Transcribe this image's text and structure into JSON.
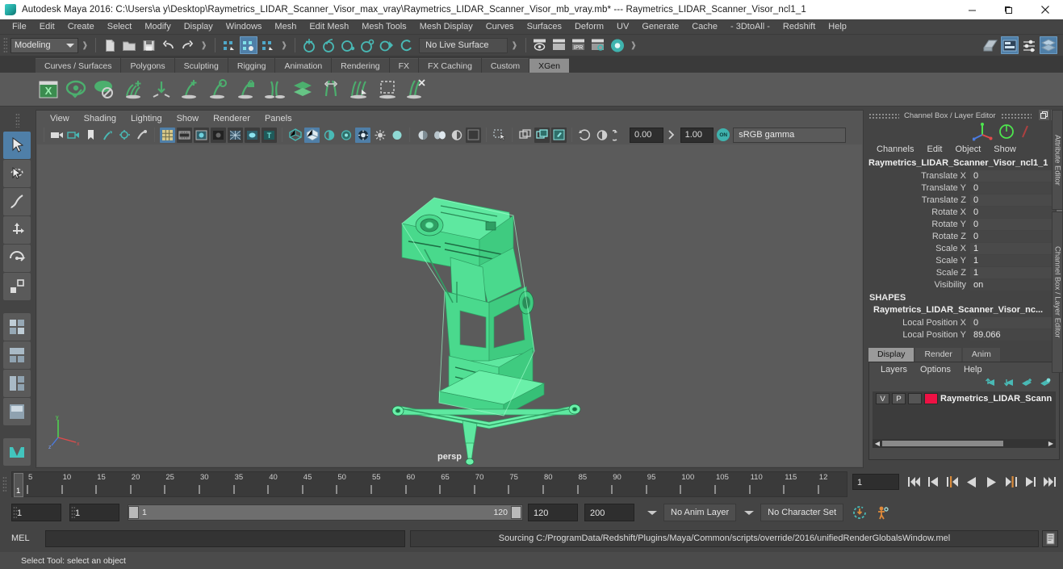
{
  "window": {
    "title": "Autodesk Maya 2016: C:\\Users\\a y\\Desktop\\Raymetrics_LIDAR_Scanner_Visor_max_vray\\Raymetrics_LIDAR_Scanner_Visor_mb_vray.mb*  ---  Raymetrics_LIDAR_Scanner_Visor_ncl1_1",
    "minimize": "—",
    "maximize": "❐",
    "close": "✕",
    "app_icon": "maya-icon"
  },
  "menubar": {
    "items": [
      "File",
      "Edit",
      "Create",
      "Select",
      "Modify",
      "Display",
      "Windows",
      "Mesh",
      "Edit Mesh",
      "Mesh Tools",
      "Mesh Display",
      "Curves",
      "Surfaces",
      "Deform",
      "UV",
      "Generate",
      "Cache",
      "- 3DtoAll -",
      "Redshift",
      "Help"
    ]
  },
  "statusline": {
    "menuset": "Modeling",
    "live_surface": "No Live Surface",
    "snap_value_1": "0.00",
    "snap_value_2": "1.00",
    "gamma": "sRGB gamma",
    "gamma_toggle": "ON",
    "icons": [
      "new-scene-icon",
      "open-scene-icon",
      "save-scene-icon",
      "undo-icon",
      "redo-icon",
      "select-by-hierarchy-icon",
      "select-by-object-icon",
      "select-by-component-icon",
      "snap-to-grid-icon",
      "snap-to-curve-icon",
      "snap-to-point-icon",
      "snap-to-projected-center-icon",
      "snap-to-view-plane-icon",
      "make-live-icon",
      "render-current-frame-icon",
      "ipr-render-icon",
      "render-settings-icon",
      "hypershade-icon",
      "render-view-icon",
      "outliner-icon",
      "attribute-editor-icon",
      "tool-settings-icon",
      "channel-box-icon"
    ]
  },
  "shelf": {
    "tabs": [
      {
        "label": "Curves / Surfaces",
        "active": false
      },
      {
        "label": "Polygons",
        "active": false
      },
      {
        "label": "Sculpting",
        "active": false
      },
      {
        "label": "Rigging",
        "active": false
      },
      {
        "label": "Animation",
        "active": false
      },
      {
        "label": "Rendering",
        "active": false
      },
      {
        "label": "FX",
        "active": false
      },
      {
        "label": "FX Caching",
        "active": false
      },
      {
        "label": "Custom",
        "active": false
      },
      {
        "label": "XGen",
        "active": true
      }
    ],
    "icons": [
      "xgen-window-icon",
      "xgen-preview-icon",
      "xgen-disable-preview-icon",
      "xgen-add-guides-icon",
      "xgen-place-guide-icon",
      "xgen-grow-guide-icon",
      "xgen-select-guide-icon",
      "xgen-lock-guide-icon",
      "xgen-mirror-guides-icon",
      "xgen-layers-icon",
      "xgen-length-tool-icon",
      "xgen-comb-brush-icon",
      "xgen-region-tool-icon",
      "xgen-delete-guides-icon"
    ]
  },
  "toolbox": {
    "items": [
      {
        "name": "select-tool",
        "selected": true
      },
      {
        "name": "lasso-select-tool",
        "selected": false
      },
      {
        "name": "paint-select-tool",
        "selected": false
      },
      {
        "name": "move-tool",
        "selected": false
      },
      {
        "name": "rotate-tool",
        "selected": false
      },
      {
        "name": "scale-tool",
        "selected": false
      },
      {
        "name": "four-view-layout-icon",
        "selected": false
      },
      {
        "name": "persp-outliner-layout-icon",
        "selected": false
      },
      {
        "name": "persp-graph-layout-icon",
        "selected": false
      },
      {
        "name": "persp-hypershade-layout-icon",
        "selected": false
      },
      {
        "name": "maya-logo-icon",
        "selected": false
      }
    ]
  },
  "viewport": {
    "menus": [
      "View",
      "Shading",
      "Lighting",
      "Show",
      "Renderer",
      "Panels"
    ],
    "camera_label": "persp",
    "toolbar_icons": [
      "select-camera-icon",
      "camera-attributes-icon",
      "bookmark-icon",
      "image-plane-icon",
      "two-sided-lighting-icon",
      "shadows-icon",
      "grid-toggle-icon",
      "film-gate-icon",
      "resolution-gate-icon",
      "gate-mask-icon",
      "wireframe-on-shaded-icon",
      "xray-icon",
      "texture-icon",
      "smooth-shade-icon",
      "flat-shade-icon",
      "wireframe-icon",
      "bounding-box-icon",
      "hardware-texturing-icon",
      "lighting-icon",
      "shadow-icon",
      "ambient-occlusion-icon",
      "motion-blur-icon",
      "multisample-icon",
      "isolate-select-icon",
      "panel-zoom-icon",
      "grab-color-icon",
      "snapshot-icon",
      "exposure-icon",
      "gamma-icon",
      "color-management-icon"
    ],
    "model_color": "#5ee8a0",
    "background_color": "#5b5b5b",
    "axis_labels": [
      "y",
      "x",
      "z"
    ]
  },
  "channel_box": {
    "panel_title": "Channel Box / Layer Editor",
    "menus": [
      "Channels",
      "Edit",
      "Object",
      "Show"
    ],
    "node_name": "Raymetrics_LIDAR_Scanner_Visor_ncl1_1",
    "transform_attrs": [
      {
        "label": "Translate X",
        "value": "0"
      },
      {
        "label": "Translate Y",
        "value": "0"
      },
      {
        "label": "Translate Z",
        "value": "0"
      },
      {
        "label": "Rotate X",
        "value": "0"
      },
      {
        "label": "Rotate Y",
        "value": "0"
      },
      {
        "label": "Rotate Z",
        "value": "0"
      },
      {
        "label": "Scale X",
        "value": "1"
      },
      {
        "label": "Scale Y",
        "value": "1"
      },
      {
        "label": "Scale Z",
        "value": "1"
      },
      {
        "label": "Visibility",
        "value": "on"
      }
    ],
    "shapes_header": "SHAPES",
    "shape_node": "Raymetrics_LIDAR_Scanner_Visor_nc...",
    "shape_attrs": [
      {
        "label": "Local Position X",
        "value": "0"
      },
      {
        "label": "Local Position Y",
        "value": "89.066"
      }
    ]
  },
  "layer_editor": {
    "tabs": [
      {
        "label": "Display",
        "active": true
      },
      {
        "label": "Render",
        "active": false
      },
      {
        "label": "Anim",
        "active": false
      }
    ],
    "menus": [
      "Layers",
      "Options",
      "Help"
    ],
    "toolbar_icons": [
      "move-layer-up-icon",
      "move-layer-down-icon",
      "new-layer-icon",
      "new-layer-from-selected-icon"
    ],
    "layers": [
      {
        "visibility": "V",
        "playback": "P",
        "shading": "",
        "color": "#ee1144",
        "name": "Raymetrics_LIDAR_Scann"
      }
    ]
  },
  "side_tabs": [
    {
      "label": "Attribute Editor"
    },
    {
      "label": "Channel Box / Layer Editor"
    }
  ],
  "timeline": {
    "ticks": [
      "5",
      "10",
      "15",
      "20",
      "25",
      "30",
      "35",
      "40",
      "45",
      "50",
      "55",
      "60",
      "65",
      "70",
      "75",
      "80",
      "85",
      "90",
      "95",
      "100",
      "105",
      "110",
      "115",
      "12"
    ],
    "current_frame": "1",
    "current_frame_field": "1",
    "playback_buttons": [
      "go-to-start-icon",
      "step-back-keyframe-icon",
      "step-back-frame-icon",
      "play-backwards-icon",
      "play-forwards-icon",
      "step-forward-frame-icon",
      "step-forward-keyframe-icon",
      "go-to-end-icon"
    ]
  },
  "range_slider": {
    "anim_start": "1",
    "anim_end": "1",
    "range_start": "1",
    "range_end": "120",
    "playback_end": "120",
    "anim_total_end": "200",
    "anim_layer": "No Anim Layer",
    "character_set": "No Character Set",
    "auto_key_icon": "auto-keyframe-icon",
    "anim_prefs_icon": "animation-preferences-icon"
  },
  "command_line": {
    "label": "MEL",
    "input_value": "",
    "input_placeholder": "",
    "output": "Sourcing C:/ProgramData/Redshift/Plugins/Maya/Common/scripts/override/2016/unifiedRenderGlobalsWindow.mel",
    "script_editor_icon": "script-editor-icon"
  },
  "help_line": {
    "text": "Select Tool: select an object"
  },
  "colors": {
    "accent_blue": "#4f7fa8",
    "teal": "#3fb3ae",
    "green": "#5ee8a0",
    "panel_bg": "#444444",
    "viewport_bg": "#5b5b5b"
  }
}
